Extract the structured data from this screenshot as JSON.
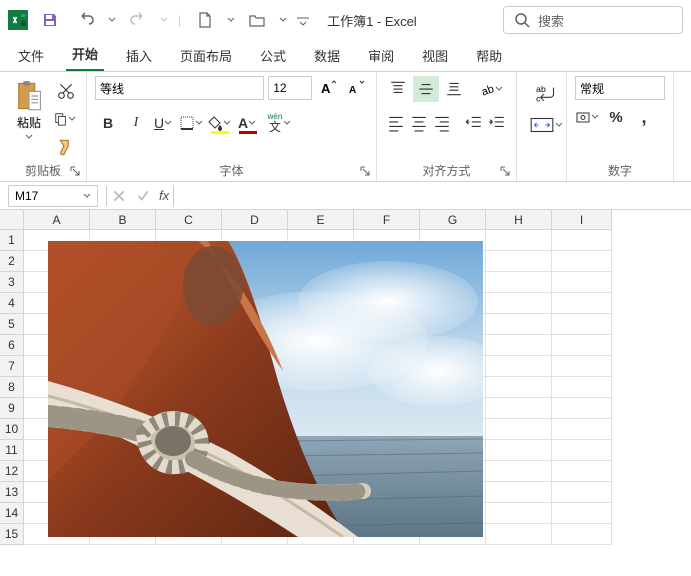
{
  "title": "工作簿1 - Excel",
  "search": {
    "placeholder": "搜索"
  },
  "tabs": [
    "文件",
    "开始",
    "插入",
    "页面布局",
    "公式",
    "数据",
    "审阅",
    "视图",
    "帮助"
  ],
  "active_tab": "开始",
  "clipboard": {
    "paste": "粘贴",
    "group_label": "剪贴板"
  },
  "font": {
    "group_label": "字体",
    "family": "等线",
    "size": "12",
    "ruby_label": "wén"
  },
  "alignment": {
    "group_label": "对齐方式"
  },
  "number": {
    "group_label": "数字",
    "format": "常规",
    "percent": "%",
    "comma": ","
  },
  "namebox": "M17",
  "columns": [
    "A",
    "B",
    "C",
    "D",
    "E",
    "F",
    "G",
    "H",
    "I"
  ],
  "rows": [
    "1",
    "2",
    "3",
    "4",
    "5",
    "6",
    "7",
    "8",
    "9",
    "10",
    "11",
    "12",
    "13",
    "14",
    "15"
  ],
  "colors": {
    "accent": "#107c41",
    "font_fill": "#ffff00",
    "font_color": "#c00000"
  },
  "image": {
    "name": "sailboat-rope-knot-photo"
  }
}
